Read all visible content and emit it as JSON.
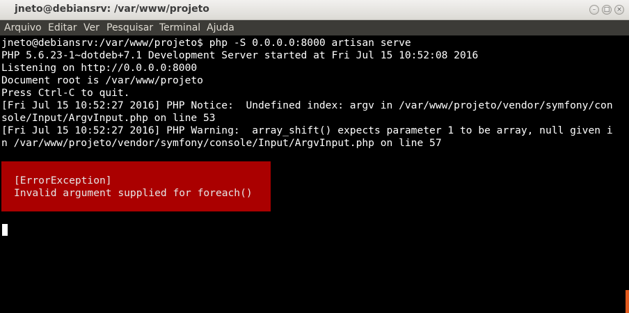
{
  "window": {
    "title": "jneto@debiansrv: /var/www/projeto",
    "minimize_glyph": "–",
    "maximize_glyph": "□",
    "close_glyph": "×"
  },
  "menu": {
    "items": [
      {
        "label": "Arquivo"
      },
      {
        "label": "Editar"
      },
      {
        "label": "Ver"
      },
      {
        "label": "Pesquisar"
      },
      {
        "label": "Terminal"
      },
      {
        "label": "Ajuda"
      }
    ]
  },
  "terminal": {
    "lines": [
      "jneto@debiansrv:/var/www/projeto$ php -S 0.0.0.0:8000 artisan serve",
      "PHP 5.6.23-1~dotdeb+7.1 Development Server started at Fri Jul 15 10:52:08 2016",
      "Listening on http://0.0.0.0:8000",
      "Document root is /var/www/projeto",
      "Press Ctrl-C to quit.",
      "[Fri Jul 15 10:52:27 2016] PHP Notice:  Undefined index: argv in /var/www/projeto/vendor/symfony/con",
      "sole/Input/ArgvInput.php on line 53",
      "[Fri Jul 15 10:52:27 2016] PHP Warning:  array_shift() expects parameter 1 to be array, null given i",
      "n /var/www/projeto/vendor/symfony/console/Input/ArgvInput.php on line 57"
    ],
    "error": {
      "type": "[ErrorException]",
      "message": "Invalid argument supplied for foreach()"
    }
  },
  "colors": {
    "terminal_bg": "#000000",
    "text": "#ffffff",
    "error_bg": "#aa0000",
    "menubar_bg": "#3c3b37",
    "scroll_accent": "#e05a1e"
  }
}
